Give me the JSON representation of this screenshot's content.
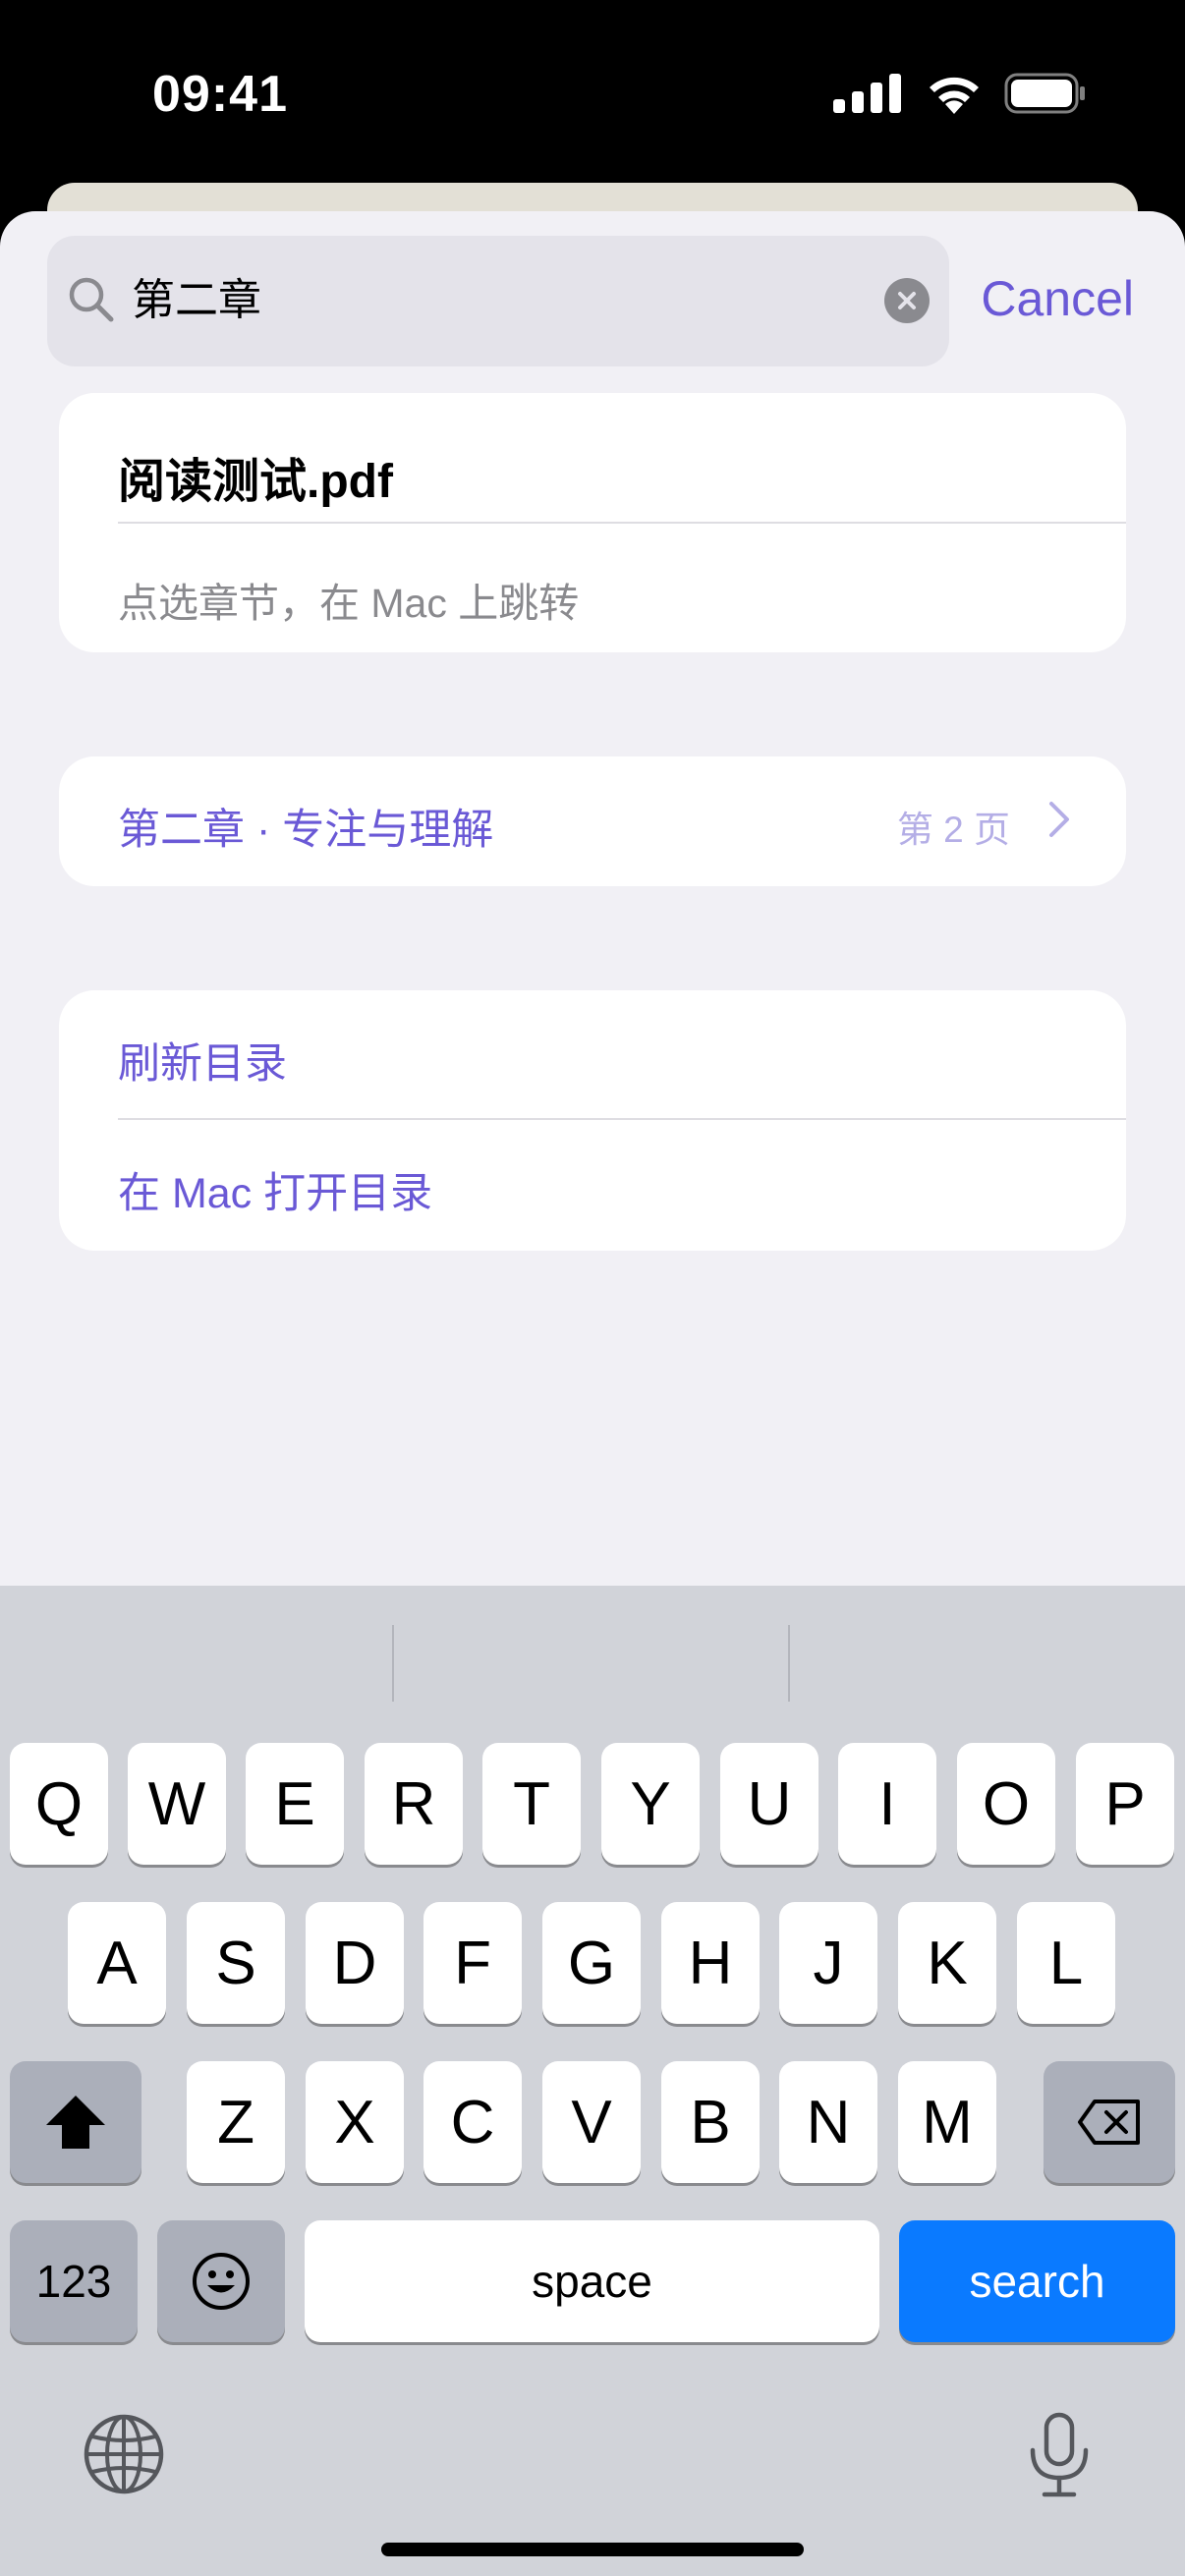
{
  "status_bar": {
    "time": "09:41",
    "icons": [
      "signal-icon",
      "wifi-icon",
      "battery-icon"
    ]
  },
  "search": {
    "query": "第二章",
    "cancel_label": "Cancel"
  },
  "document": {
    "title": "阅读测试.pdf",
    "hint": "点选章节，在 Mac 上跳转"
  },
  "result": {
    "title": "第二章 · 专注与理解",
    "page": "第 2 页"
  },
  "actions": [
    {
      "label": "刷新目录"
    },
    {
      "label": "在 Mac 打开目录"
    }
  ],
  "keyboard": {
    "row1": [
      "Q",
      "W",
      "E",
      "R",
      "T",
      "Y",
      "U",
      "I",
      "O",
      "P"
    ],
    "row2": [
      "A",
      "S",
      "D",
      "F",
      "G",
      "H",
      "J",
      "K",
      "L"
    ],
    "row3": [
      "Z",
      "X",
      "C",
      "V",
      "B",
      "N",
      "M"
    ],
    "numbers_label": "123",
    "space_label": "space",
    "search_label": "search"
  },
  "colors": {
    "accent": "#6a59d6",
    "sheet_bg": "#f1f0f5",
    "keyboard_bg": "#d1d3d9",
    "search_key": "#0a7aff"
  }
}
